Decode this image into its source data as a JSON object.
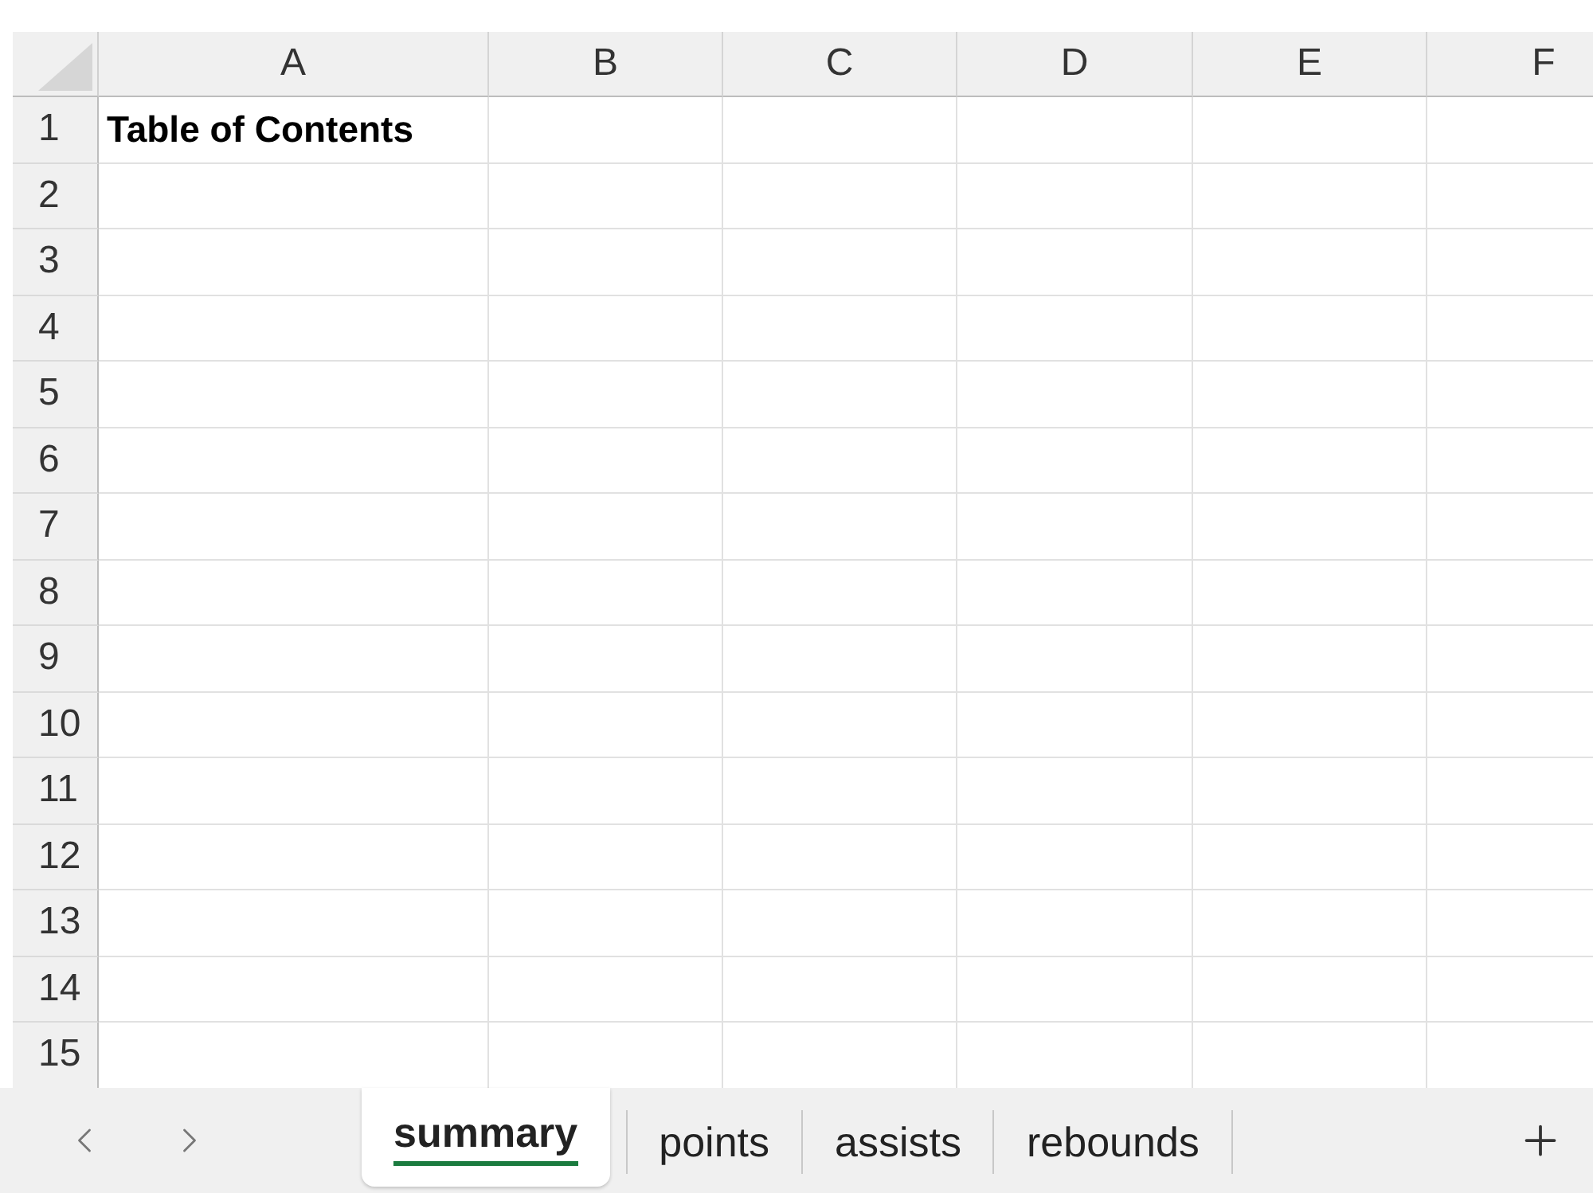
{
  "columns": [
    "A",
    "B",
    "C",
    "D",
    "E",
    "F"
  ],
  "rows": [
    {
      "header": "1",
      "cells": [
        "Table of Contents"
      ]
    },
    {
      "header": "2"
    },
    {
      "header": "3"
    },
    {
      "header": "4"
    },
    {
      "header": "5"
    },
    {
      "header": "6"
    },
    {
      "header": "7"
    },
    {
      "header": "8"
    },
    {
      "header": "9"
    },
    {
      "header": "10"
    },
    {
      "header": "11"
    },
    {
      "header": "12"
    },
    {
      "header": "13"
    },
    {
      "header": "14"
    },
    {
      "header": "15"
    }
  ],
  "sheet_tabs": [
    {
      "label": "summary",
      "selected": true
    },
    {
      "label": "points",
      "selected": false
    },
    {
      "label": "assists",
      "selected": false
    },
    {
      "label": "rebounds",
      "selected": false
    }
  ]
}
